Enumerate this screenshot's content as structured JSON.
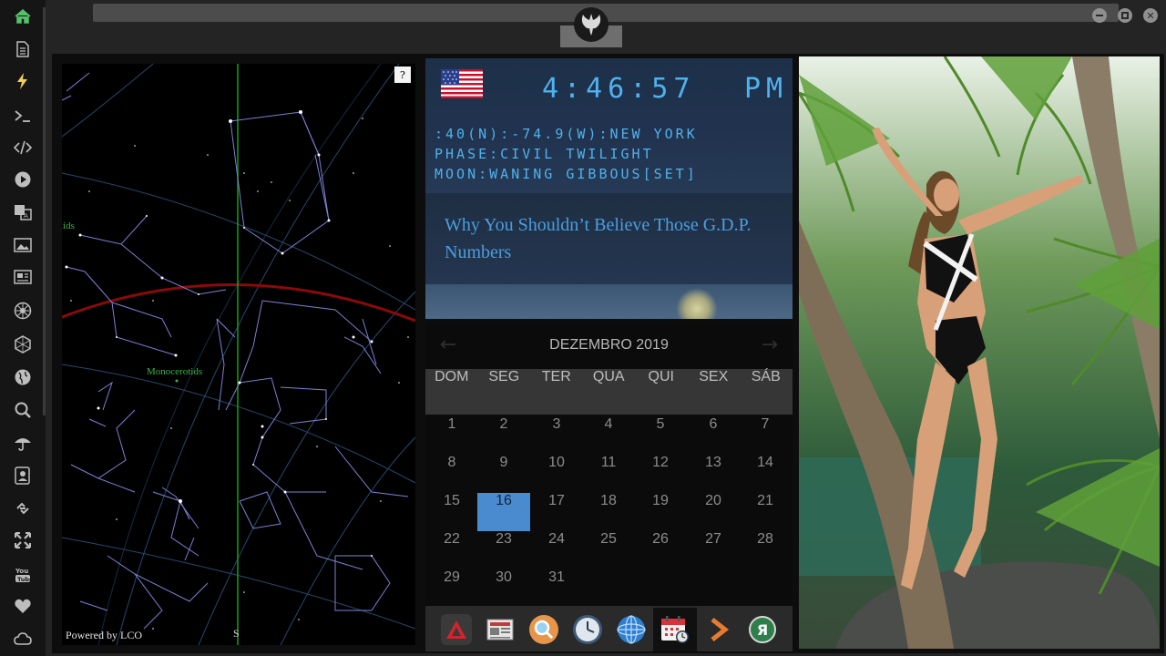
{
  "sidebar": {
    "items": [
      {
        "name": "home",
        "icon": "home-icon",
        "color": "#55c26a"
      },
      {
        "name": "document",
        "icon": "document-icon",
        "color": "#bdbdbd"
      },
      {
        "name": "lightning",
        "icon": "lightning-icon",
        "color": "#f2d24b"
      },
      {
        "name": "terminal",
        "icon": "terminal-icon",
        "color": "#bdbdbd"
      },
      {
        "name": "code",
        "icon": "code-icon",
        "color": "#bdbdbd"
      },
      {
        "name": "play",
        "icon": "play-icon",
        "color": "#bdbdbd"
      },
      {
        "name": "translate",
        "icon": "translate-icon",
        "color": "#bdbdbd"
      },
      {
        "name": "image",
        "icon": "image-icon",
        "color": "#bdbdbd"
      },
      {
        "name": "news",
        "icon": "newspaper-icon",
        "color": "#bdbdbd"
      },
      {
        "name": "settings",
        "icon": "gear-icon",
        "color": "#bdbdbd"
      },
      {
        "name": "hexagon",
        "icon": "hexagon-icon",
        "color": "#bdbdbd"
      },
      {
        "name": "globe",
        "icon": "globe-icon",
        "color": "#bdbdbd"
      },
      {
        "name": "search",
        "icon": "search-icon",
        "color": "#bdbdbd"
      },
      {
        "name": "weather",
        "icon": "umbrella-icon",
        "color": "#bdbdbd"
      },
      {
        "name": "contacts",
        "icon": "contact-card-icon",
        "color": "#bdbdbd"
      },
      {
        "name": "links",
        "icon": "link-icon",
        "color": "#bdbdbd"
      },
      {
        "name": "fullscreen",
        "icon": "expand-icon",
        "color": "#bdbdbd"
      },
      {
        "name": "youtube",
        "icon": "youtube-icon",
        "color": "#bdbdbd"
      },
      {
        "name": "favorites",
        "icon": "heart-icon",
        "color": "#bdbdbd"
      },
      {
        "name": "cloud",
        "icon": "cloud-icon",
        "color": "#bdbdbd"
      }
    ]
  },
  "window": {
    "logo_icon": "rebel-alliance-icon",
    "minimize_icon": "minimize-icon",
    "maximize_icon": "maximize-icon",
    "close_icon": "close-icon"
  },
  "skymap": {
    "help_label": "?",
    "constellation_left": "iids",
    "constellation_mid": "Monocerotids",
    "south_label": "S",
    "credit": "Powered by LCO",
    "colors": {
      "ecliptic": "#8b0a0a",
      "meridian": "#1e9d1e",
      "lines": "#7f7fd6",
      "grid": "#2f5c8a",
      "labels": "#3fb24a"
    }
  },
  "clock": {
    "flag_icon": "us-flag-icon",
    "time": "4:46:57",
    "ampm": "PM",
    "location": ":40(N):-74.9(W):NEW YORK",
    "phase": "PHASE:CIVIL TWILIGHT",
    "moon": "MOON:WANING GIBBOUS[SET]",
    "color": "#4fb2ee"
  },
  "news": {
    "headline": "Why You Shouldn’t Believe Those G.D.P. Numbers"
  },
  "calendar": {
    "month": "DEZEMBRO 2019",
    "prev_label": "←",
    "next_label": "→",
    "weekdays": [
      "DOM",
      "SEG",
      "TER",
      "QUA",
      "QUI",
      "SEX",
      "SÁB"
    ],
    "weeks": [
      [
        "1",
        "2",
        "3",
        "4",
        "5",
        "6",
        "7"
      ],
      [
        "8",
        "9",
        "10",
        "11",
        "12",
        "13",
        "14"
      ],
      [
        "15",
        "16",
        "17",
        "18",
        "19",
        "20",
        "21"
      ],
      [
        "22",
        "23",
        "24",
        "25",
        "26",
        "27",
        "28"
      ],
      [
        "29",
        "30",
        "31"
      ]
    ],
    "today": "16",
    "today_color": "#4a8bd0"
  },
  "dock": {
    "items": [
      {
        "name": "app-launcher",
        "icon": "red-triangle-icon"
      },
      {
        "name": "news-reader",
        "icon": "newspaper-icon"
      },
      {
        "name": "search",
        "icon": "magnifier-icon"
      },
      {
        "name": "clock",
        "icon": "clock-icon"
      },
      {
        "name": "browser",
        "icon": "globe-icon"
      },
      {
        "name": "calendar",
        "icon": "calendar-icon"
      },
      {
        "name": "forward",
        "icon": "chevron-right-icon"
      },
      {
        "name": "yandex",
        "icon": "ya-icon",
        "label": "Я"
      }
    ]
  }
}
